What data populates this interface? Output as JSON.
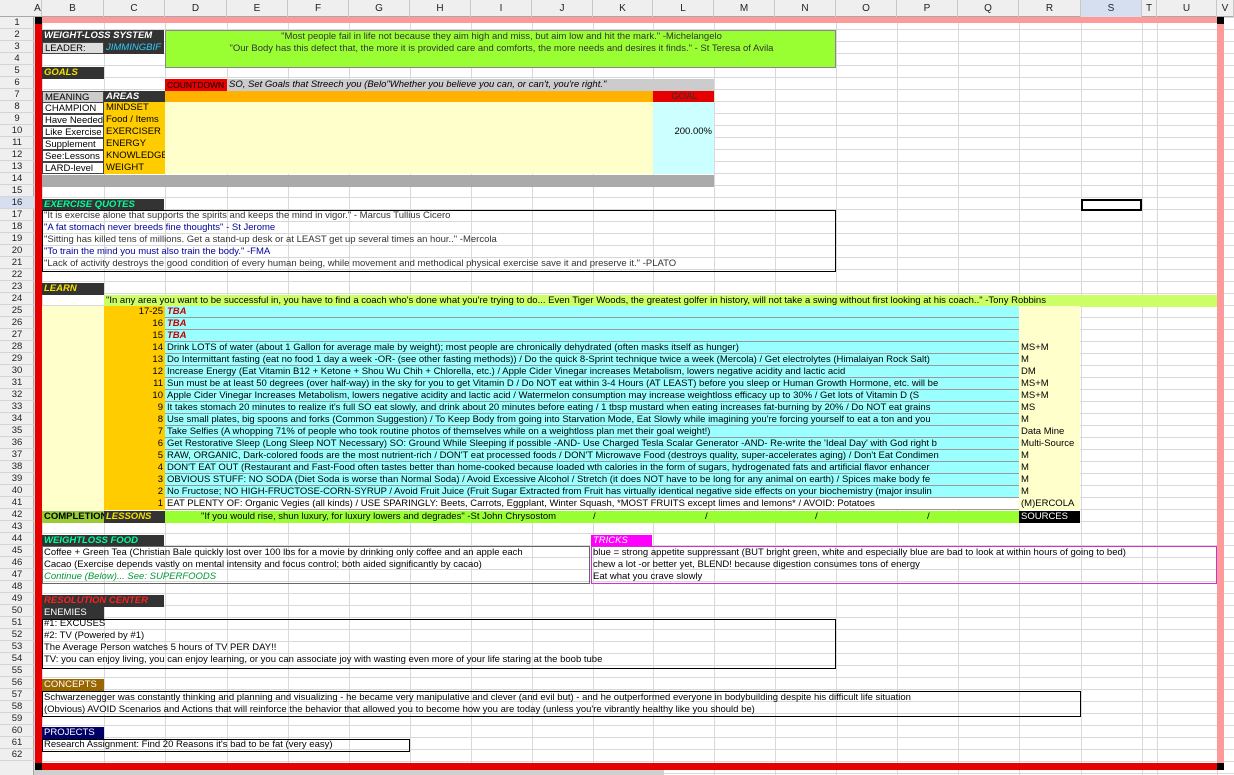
{
  "columns": [
    "A",
    "B",
    "C",
    "D",
    "E",
    "F",
    "G",
    "H",
    "I",
    "J",
    "K",
    "L",
    "M",
    "N",
    "O",
    "P",
    "Q",
    "R",
    "S",
    "T",
    "U",
    "V"
  ],
  "selected_column": "S",
  "selected_row": "16",
  "rows": [
    "1",
    "2",
    "3",
    "4",
    "5",
    "6",
    "7",
    "8",
    "9",
    "10",
    "11",
    "12",
    "13",
    "14",
    "15",
    "16",
    "17",
    "18",
    "19",
    "20",
    "21",
    "22",
    "23",
    "24",
    "25",
    "26",
    "27",
    "28",
    "29",
    "30",
    "31",
    "32",
    "33",
    "34",
    "35",
    "36",
    "37",
    "38",
    "39",
    "40",
    "41",
    "42",
    "43",
    "44",
    "45",
    "46",
    "47",
    "48",
    "49",
    "50",
    "51",
    "52",
    "53",
    "54",
    "55",
    "56",
    "57",
    "58",
    "59",
    "60",
    "61",
    "62"
  ],
  "header": {
    "title": "WEIGHT-LOSS SYSTEM",
    "leader_label": "LEADER:",
    "leader_value": "JIMMINGBIF",
    "quote1": "\"Most people fail in life not because they aim high and miss, but aim low and hit the mark.\" -Michelangelo",
    "quote2": "\"Our Body has this defect that, the more it is provided care and comforts, the more needs and desires it finds.\" - St Teresa of Avila"
  },
  "goals": {
    "section": "GOALS",
    "countdown": "COUNTDOWN",
    "set_goals": "SO, Set Goals that Streech you (Belo",
    "whether": "\"Whether you believe you can, or can't, you're right.\"",
    "goal_header": "GOAL",
    "meaning_header": "MEANING",
    "areas_header": "AREAS",
    "rows": [
      {
        "meaning": "CHAMPION",
        "area": "MINDSET",
        "goal": ""
      },
      {
        "meaning": "Have Needed",
        "area": "Food / Items",
        "goal": ""
      },
      {
        "meaning": "Like Exercise",
        "area": "EXERCISER",
        "goal": "200.00%"
      },
      {
        "meaning": "Supplement",
        "area": "ENERGY",
        "goal": ""
      },
      {
        "meaning": "See:Lessons",
        "area": "KNOWLEDGE",
        "goal": ""
      },
      {
        "meaning": "LARD-level",
        "area": "WEIGHT",
        "goal": ""
      }
    ]
  },
  "exercise_quotes": {
    "section": "EXERCISE QUOTES",
    "items": [
      "\"It is exercise alone that supports the spirits and keeps the mind in vigor.\" - Marcus Tullius Cicero",
      "\"A fat stomach never breeds fine thoughts\" - St Jerome",
      "\"Sitting has killed tens of millions. Get a stand-up desk or at LEAST get up several times an hour..\" -Mercola",
      "\"To train the mind you must also train the body.\" -FMA",
      "\"Lack of activity destroys the good condition of every human being, while movement and methodical physical exercise save it and preserve it.\" -PLATO"
    ]
  },
  "learn": {
    "section": "LEARN",
    "quote": "\"In any area you want to be successful in, you have to find a coach who's done what you're trying to do... Even Tiger Woods, the greatest golfer in history, will not take a swing without first looking at his coach..\" -Tony Robbins",
    "items": [
      {
        "num": "17-25",
        "text": "TBA",
        "src": ""
      },
      {
        "num": "16",
        "text": "TBA",
        "src": ""
      },
      {
        "num": "15",
        "text": "TBA",
        "src": ""
      },
      {
        "num": "14",
        "text": "Drink LOTS of water (about 1 Gallon for average male by weight); most people are chronically dehydrated (often masks itself as hunger)",
        "src": "MS+M"
      },
      {
        "num": "13",
        "text": "Do Intermittant fasting (eat no food 1 day a week -OR- (see other fasting methods)) / Do the quick 8-Sprint technique twice a week (Mercola) / Get electrolytes (Himalaiyan Rock Salt)",
        "src": "M"
      },
      {
        "num": "12",
        "text": "Increase Energy (Eat Vitamin B12 + Ketone + Shou Wu Chih + Chlorella, etc.) / Apple Cider Vinegar increases Metabolism, lowers negative acidity and lactic acid",
        "src": "DM"
      },
      {
        "num": "11",
        "text": "Sun must be at least 50 degrees (over half-way) in the sky for you to get Vitamin D / Do NOT eat within 3-4 Hours (AT LEAST) before you sleep or Human Growth Hormone, etc. will be",
        "src": "MS+M"
      },
      {
        "num": "10",
        "text": "Apple Cider Vinegar Increases Metabolism, lowers negative acidity and lactic acid / Watermelon consumption may increase weightloss efficacy up to 30% / Get lots of Vitamin D (S",
        "src": "MS+M"
      },
      {
        "num": "9",
        "text": "It takes stomach 20 minutes to realize it's full SO eat slowly, and drink about 20 minutes before eating / 1 tbsp mustard when eating increases fat-burning by 20% / Do NOT eat grains",
        "src": "MS"
      },
      {
        "num": "8",
        "text": "Use small plates, big spoons and forks (Common Suggestion) / To Keep Body from going into Starvation Mode, Eat Slowly while imagining you're forcing yourself to eat a ton and you",
        "src": "M"
      },
      {
        "num": "7",
        "text": "Take Selfies (A whopping 71% of people who took routine photos of themselves while on a weightloss plan met their goal weight!)",
        "src": "Data Mine"
      },
      {
        "num": "6",
        "text": "Get Restorative Sleep (Long Sleep NOT Necessary) SO: Ground While Sleeping if possible -AND- Use Charged Tesla Scalar Generator -AND- Re-write the 'Ideal Day' with God right b",
        "src": "Multi-Source"
      },
      {
        "num": "5",
        "text": "RAW, ORGANIC, Dark-colored foods are the most nutrient-rich / DON'T eat processed foods / DON'T Microwave Food (destroys quality, super-accelerates aging) / Don't Eat Condimen",
        "src": "M"
      },
      {
        "num": "4",
        "text": "DON'T EAT OUT (Restaurant and Fast-Food often tastes better than home-cooked because loaded wth calories in the form of sugars, hydrogenated fats and artificial flavor enhancer",
        "src": "M"
      },
      {
        "num": "3",
        "text": "OBVIOUS STUFF: NO SODA (Diet Soda is worse than Normal Soda) / Avoid Excessive Alcohol / Stretch (it does NOT have to be long for any animal on earth) / Spices make body fe",
        "src": "M"
      },
      {
        "num": "2",
        "text": "No Fructose; NO HIGH-FRUCTOSE-CORN-SYRUP / Avoid Fruit Juice (Fruit Sugar Extracted from Fruit has virtually identical negative side effects on your biochemistry (major insulin",
        "src": "M"
      },
      {
        "num": "1",
        "text": "EAT PLENTY OF: Organic Vegies (all kinds) / USE SPARINGLY: Beets, Carrots, Eggplant, Winter Squash, *MOST FRUITS except limes and lemons* / AVOID: Potatoes",
        "src": "(M)ERCOLA"
      }
    ],
    "completion": "COMPLETION",
    "lessons": "LESSONS",
    "last_quote": "\"If you would rise, shun luxury, for luxury lowers and degrades\" -St John Chrysostom",
    "slashes": [
      "/",
      "/",
      "/",
      "/"
    ],
    "sources": "SOURCES"
  },
  "weightloss_food": {
    "section": "WEIGHTLOSS FOOD",
    "items": [
      "Coffee + Green Tea (Christian Bale quickly lost over 100 lbs for a movie by drinking only coffee and an apple each",
      "Cacao (Exercise depends vastly on mental intensity and focus control; both aided significantly by cacao)"
    ],
    "continue": "Continue (Below)... See: SUPERFOODS"
  },
  "tricks": {
    "section": "TRICKS",
    "items": [
      "blue = strong appetite suppressant (BUT bright green, white and especially blue are bad to look at within hours of going to bed)",
      "chew a lot -or better yet, BLEND! because digestion consumes tons of energy",
      "Eat what you crave slowly"
    ]
  },
  "resolution": {
    "section": "RESOLUTION CENTER",
    "enemies_label": "ENEMIES",
    "enemies": [
      "#1: EXCUSES",
      "#2: TV (Powered by #1)",
      "The Average Person watches 5 hours of TV PER DAY!!",
      "TV: you can enjoy living, you can enjoy learning, or you can associate joy with wasting even more of your life staring at the boob tube"
    ],
    "concepts_label": "CONCEPTS",
    "concepts": [
      "Schwarzenegger was constantly thinking and planning and visualizing - he became very manipulative and clever (and evil but) - and he outperformed everyone in bodybuilding despite his difficult life situation",
      "(Obvious) AVOID Scenarios and Actions that will reinforce the behavior that allowed you to become how you are today (unless you're vibrantly healthy like you should be)"
    ],
    "projects_label": "PROJECTS",
    "projects": [
      "Research Assignment: Find 20 Reasons it's bad to be fat (very easy)"
    ]
  },
  "colors": {
    "accent_red": "#e60000",
    "pink_border": "#ff9a9a",
    "lime": "#99ff33",
    "light_yellow": "#ffffcc",
    "light_cyan": "#ccffff",
    "cyan": "#99ffff",
    "orange": "#ffcc00",
    "magenta": "#ff00ff"
  }
}
